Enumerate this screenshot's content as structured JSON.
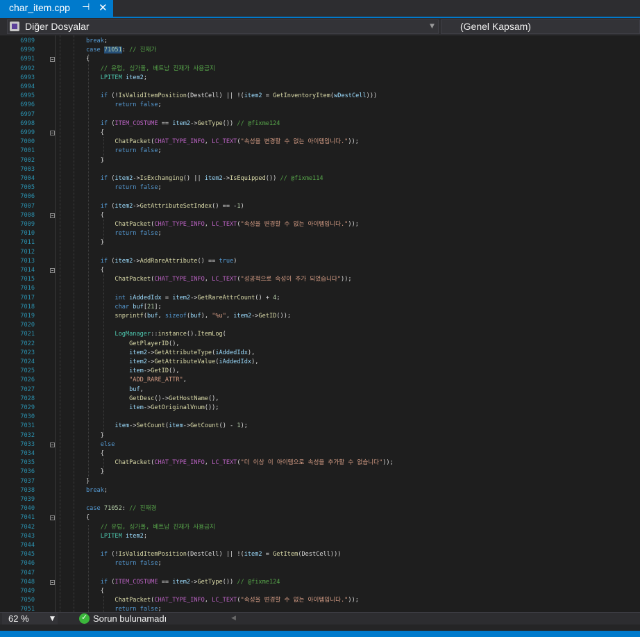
{
  "tab": {
    "title": "char_item.cpp",
    "pin_glyph": "⊣",
    "close_glyph": "✕"
  },
  "nav": {
    "left_label": "Diğer Dosyalar",
    "right_label": "(Genel Kapsam)"
  },
  "status": {
    "zoom": "62 %",
    "issues": "Sorun bulunamadı"
  },
  "colors": {
    "accent": "#007acc",
    "status_ok": "#3bb63b"
  },
  "code_lines": [
    {
      "n": "6989",
      "fold": false,
      "t": "break;"
    },
    {
      "n": "6990",
      "fold": false,
      "t": "case 71051: // 진재가"
    },
    {
      "n": "6991",
      "fold": true,
      "t": "{"
    },
    {
      "n": "6992",
      "fold": false,
      "t": "    // 유럽, 싱가폴, 베트남 진재가 사용금지"
    },
    {
      "n": "6993",
      "fold": false,
      "t": "    LPITEM item2;"
    },
    {
      "n": "6994",
      "fold": false,
      "t": ""
    },
    {
      "n": "6995",
      "fold": false,
      "t": "    if (!IsValidItemPosition(DestCell) || !(item2 = GetInventoryItem(wDestCell)))"
    },
    {
      "n": "6996",
      "fold": false,
      "t": "        return false;"
    },
    {
      "n": "6997",
      "fold": false,
      "t": ""
    },
    {
      "n": "6998",
      "fold": false,
      "t": "    if (ITEM_COSTUME == item2->GetType()) // @fixme124"
    },
    {
      "n": "6999",
      "fold": true,
      "t": "    {"
    },
    {
      "n": "7000",
      "fold": false,
      "t": "        ChatPacket(CHAT_TYPE_INFO, LC_TEXT(\"속성을 변경할 수 없는 아이템입니다.\"));"
    },
    {
      "n": "7001",
      "fold": false,
      "t": "        return false;"
    },
    {
      "n": "7002",
      "fold": false,
      "t": "    }"
    },
    {
      "n": "7003",
      "fold": false,
      "t": ""
    },
    {
      "n": "7004",
      "fold": false,
      "t": "    if (item2->IsExchanging() || item2->IsEquipped()) // @fixme114"
    },
    {
      "n": "7005",
      "fold": false,
      "t": "        return false;"
    },
    {
      "n": "7006",
      "fold": false,
      "t": ""
    },
    {
      "n": "7007",
      "fold": false,
      "t": "    if (item2->GetAttributeSetIndex() == -1)"
    },
    {
      "n": "7008",
      "fold": true,
      "t": "    {"
    },
    {
      "n": "7009",
      "fold": false,
      "t": "        ChatPacket(CHAT_TYPE_INFO, LC_TEXT(\"속성을 변경할 수 없는 아이템입니다.\"));"
    },
    {
      "n": "7010",
      "fold": false,
      "t": "        return false;"
    },
    {
      "n": "7011",
      "fold": false,
      "t": "    }"
    },
    {
      "n": "7012",
      "fold": false,
      "t": ""
    },
    {
      "n": "7013",
      "fold": false,
      "t": "    if (item2->AddRareAttribute() == true)"
    },
    {
      "n": "7014",
      "fold": true,
      "t": "    {"
    },
    {
      "n": "7015",
      "fold": false,
      "t": "        ChatPacket(CHAT_TYPE_INFO, LC_TEXT(\"성공적으로 속성이 추가 되었습니다\"));"
    },
    {
      "n": "7016",
      "fold": false,
      "t": ""
    },
    {
      "n": "7017",
      "fold": false,
      "t": "        int iAddedIdx = item2->GetRareAttrCount() + 4;"
    },
    {
      "n": "7018",
      "fold": false,
      "t": "        char buf[21];"
    },
    {
      "n": "7019",
      "fold": false,
      "t": "        snprintf(buf, sizeof(buf), \"%u\", item2->GetID());"
    },
    {
      "n": "7020",
      "fold": false,
      "t": ""
    },
    {
      "n": "7021",
      "fold": false,
      "t": "        LogManager::instance().ItemLog("
    },
    {
      "n": "7022",
      "fold": false,
      "t": "            GetPlayerID(),"
    },
    {
      "n": "7023",
      "fold": false,
      "t": "            item2->GetAttributeType(iAddedIdx),"
    },
    {
      "n": "7024",
      "fold": false,
      "t": "            item2->GetAttributeValue(iAddedIdx),"
    },
    {
      "n": "7025",
      "fold": false,
      "t": "            item->GetID(),"
    },
    {
      "n": "7026",
      "fold": false,
      "t": "            \"ADD_RARE_ATTR\","
    },
    {
      "n": "7027",
      "fold": false,
      "t": "            buf,"
    },
    {
      "n": "7028",
      "fold": false,
      "t": "            GetDesc()->GetHostName(),"
    },
    {
      "n": "7029",
      "fold": false,
      "t": "            item->GetOriginalVnum());"
    },
    {
      "n": "7030",
      "fold": false,
      "t": ""
    },
    {
      "n": "7031",
      "fold": false,
      "t": "        item->SetCount(item->GetCount() - 1);"
    },
    {
      "n": "7032",
      "fold": false,
      "t": "    }"
    },
    {
      "n": "7033",
      "fold": true,
      "t": "    else"
    },
    {
      "n": "7034",
      "fold": false,
      "t": "    {"
    },
    {
      "n": "7035",
      "fold": false,
      "t": "        ChatPacket(CHAT_TYPE_INFO, LC_TEXT(\"더 이상 이 아이템으로 속성을 추가할 수 없습니다\"));"
    },
    {
      "n": "7036",
      "fold": false,
      "t": "    }"
    },
    {
      "n": "7037",
      "fold": false,
      "t": "}"
    },
    {
      "n": "7038",
      "fold": false,
      "t": "break;"
    },
    {
      "n": "7039",
      "fold": false,
      "t": ""
    },
    {
      "n": "7040",
      "fold": false,
      "t": "case 71052: // 진재경"
    },
    {
      "n": "7041",
      "fold": true,
      "t": "{"
    },
    {
      "n": "7042",
      "fold": false,
      "t": "    // 유럽, 싱가폴, 베트남 진재가 사용금지"
    },
    {
      "n": "7043",
      "fold": false,
      "t": "    LPITEM item2;"
    },
    {
      "n": "7044",
      "fold": false,
      "t": ""
    },
    {
      "n": "7045",
      "fold": false,
      "t": "    if (!IsValidItemPosition(DestCell) || !(item2 = GetItem(DestCell)))"
    },
    {
      "n": "7046",
      "fold": false,
      "t": "        return false;"
    },
    {
      "n": "7047",
      "fold": false,
      "t": ""
    },
    {
      "n": "7048",
      "fold": true,
      "t": "    if (ITEM_COSTUME == item2->GetType()) // @fixme124"
    },
    {
      "n": "7049",
      "fold": false,
      "t": "    {"
    },
    {
      "n": "7050",
      "fold": false,
      "t": "        ChatPacket(CHAT_TYPE_INFO, LC_TEXT(\"속성을 변경할 수 없는 아이템입니다.\"));"
    },
    {
      "n": "7051",
      "fold": false,
      "t": "        return false;"
    }
  ]
}
